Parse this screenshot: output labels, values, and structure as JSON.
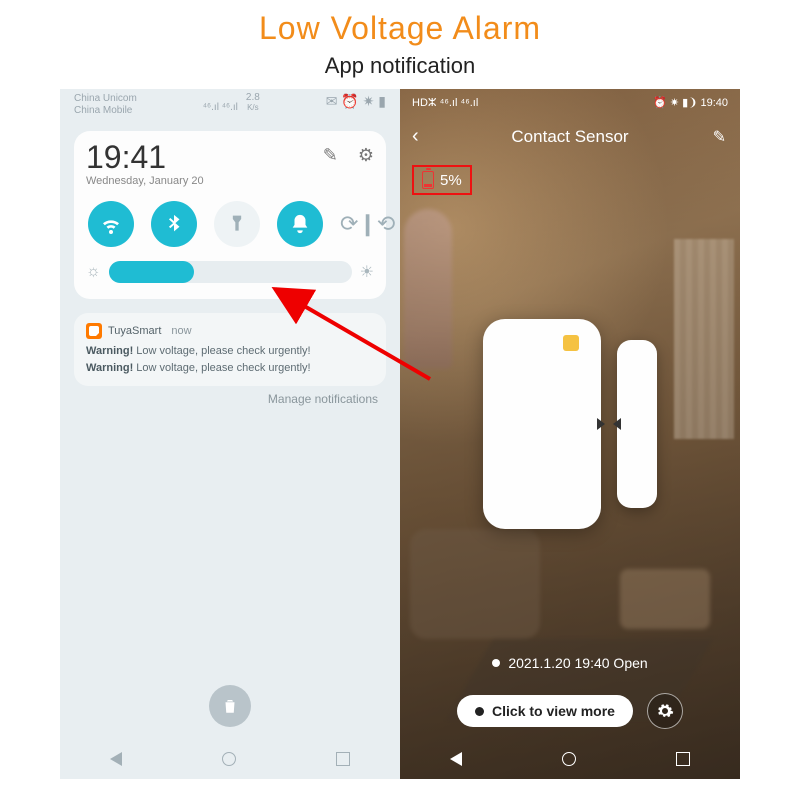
{
  "page": {
    "title": "Low Voltage Alarm",
    "subtitle": "App notification"
  },
  "left": {
    "status": {
      "carrier1": "China Unicom",
      "carrier2": "China Mobile",
      "signal": "⁴⁶.ıl   ⁴⁶.ıl",
      "speed": "2.8",
      "speed_unit": "K/s",
      "icons": "✉ ⏰ ✷ ▮"
    },
    "panel": {
      "time": "19:41",
      "date": "Wednesday, January 20"
    },
    "notif": {
      "app": "TuyaSmart",
      "when": "now",
      "line1_bold": "Warning!",
      "line1_rest": " Low voltage, please check urgently!",
      "line2_bold": "Warning!",
      "line2_rest": " Low voltage, please check urgently!"
    },
    "manage": "Manage notifications"
  },
  "right": {
    "status": {
      "left": "HDⵣ  ⁴⁶.ıl  ⁴⁶.ıl",
      "right": "⏰ ✷ ▮❩ 19:40"
    },
    "header": {
      "title": "Contact Sensor"
    },
    "battery": "5%",
    "event": "2021.1.20 19:40 Open",
    "view_more": "Click to view more"
  }
}
